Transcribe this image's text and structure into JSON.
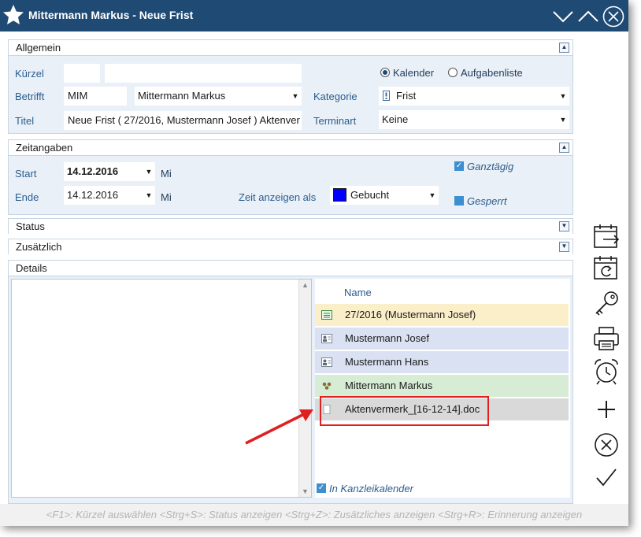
{
  "window": {
    "title": "Mittermann Markus - Neue Frist",
    "accent": "#1f4a74"
  },
  "allgemein": {
    "header": "Allgemein",
    "kuerzel_label": "Kürzel",
    "kuerzel_value": "",
    "kuerzel_name": "",
    "betrifft_label": "Betrifft",
    "betrifft_code": "MIM",
    "betrifft_name": "Mittermann Markus",
    "titel_label": "Titel",
    "titel_value": "Neue Frist ( 27/2016, Mustermann Josef ) Aktenver",
    "radio_kalender": "Kalender",
    "radio_aufgabenliste": "Aufgabenliste",
    "kategorie_label": "Kategorie",
    "kategorie_value": "Frist",
    "terminart_label": "Terminart",
    "terminart_value": "Keine"
  },
  "zeitangaben": {
    "header": "Zeitangaben",
    "start_label": "Start",
    "start_value": "14.12.2016",
    "start_day": "Mi",
    "ende_label": "Ende",
    "ende_value": "14.12.2016",
    "ende_day": "Mi",
    "ganztaegig_label": "Ganztägig",
    "zeit_anzeigen_label": "Zeit anzeigen als",
    "zeit_anzeigen_value": "Gebucht",
    "zeit_color": "#0000ff",
    "gesperrt_label": "Gesperrt"
  },
  "status": {
    "header": "Status"
  },
  "zusaetzlich": {
    "header": "Zusätzlich"
  },
  "details": {
    "header": "Details",
    "text": "",
    "list_header": "Name",
    "items": [
      {
        "name": "27/2016 (Mustermann Josef)",
        "icon": "file-record-icon",
        "color": "#fbefc9"
      },
      {
        "name": "Mustermann Josef",
        "icon": "contact-card-icon",
        "color": "#d9e1f2"
      },
      {
        "name": "Mustermann Hans",
        "icon": "contact-card-icon",
        "color": "#d9e1f2"
      },
      {
        "name": "Mittermann Markus",
        "icon": "user-group-icon",
        "color": "#d7ecd4"
      },
      {
        "name": "Aktenvermerk_[16-12-14].doc",
        "icon": "document-icon",
        "color": "#d9d9d9"
      }
    ],
    "kanzlei_label": "In Kanzleikalender"
  },
  "statusbar": {
    "text": "<F1>: Kürzel auswählen <Strg+S>: Status anzeigen <Strg+Z>: Zusätzliches anzeigen <Strg+R>: Erinnerung anzeigen"
  },
  "annotation": {
    "highlight_color": "#e02020"
  }
}
